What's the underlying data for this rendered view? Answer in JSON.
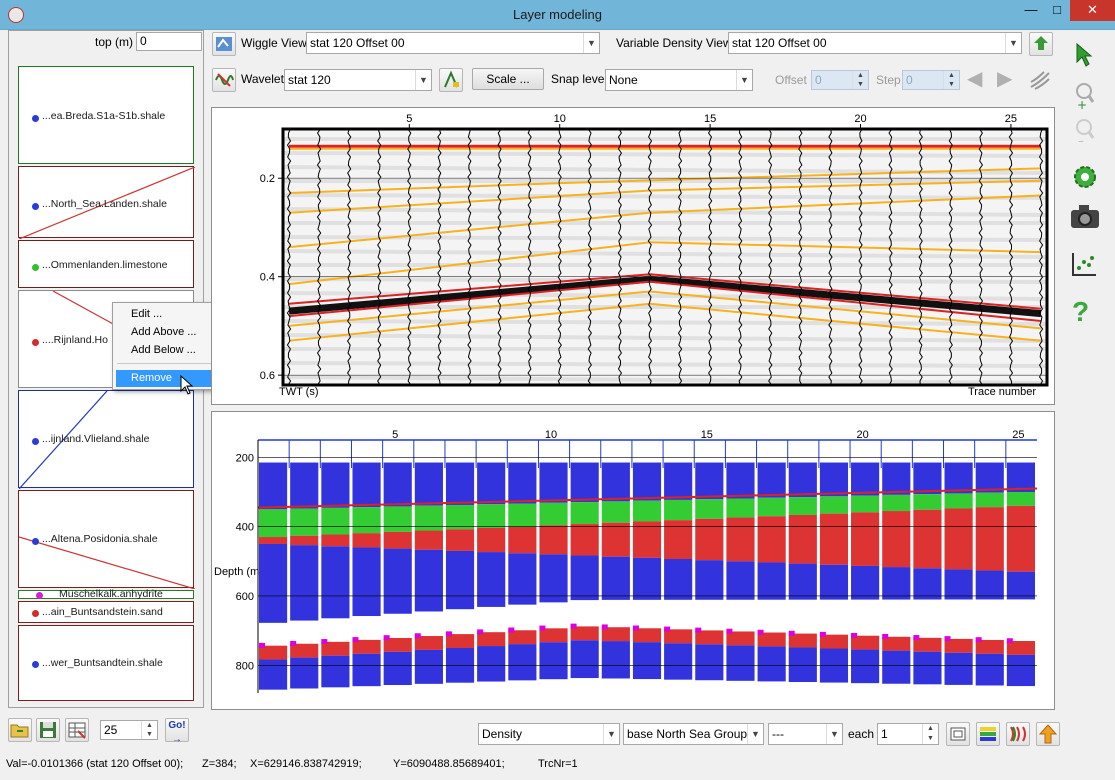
{
  "window": {
    "title": "Layer modeling"
  },
  "top": {
    "label": "top (m)",
    "value": "0"
  },
  "layers": [
    {
      "name": "...ea.Breda.S1a-S1b.shale",
      "dot": "#2b3bd9",
      "border": "#1f7a1f"
    },
    {
      "name": "...North_Sea.Landen.shale",
      "dot": "#2b3bd9",
      "border": "#7a1f1f"
    },
    {
      "name": "...Ommenlanden.limestone",
      "dot": "#2fbf2f",
      "border": "#6b1f1f"
    },
    {
      "name": "....Rijnland.Ho",
      "dot": "#d42a2a",
      "border": "#8a8a8a"
    },
    {
      "name": "...ijnland.Vlieland.shale",
      "dot": "#2b3bd9",
      "border": "#1f2f9a"
    },
    {
      "name": "...Altena.Posidonia.shale",
      "dot": "#2b3bd9",
      "border": "#7a1f1f"
    },
    {
      "name": "Muschelkalk.anhydrite",
      "dot": "#d420d4",
      "border": "#2a7a2a"
    },
    {
      "name": "...ain_Buntsandstein.sand",
      "dot": "#d42a2a",
      "border": "#7a1f1f"
    },
    {
      "name": "...wer_Buntsandtein.shale",
      "dot": "#2b3bd9",
      "border": "#7a1f1f"
    }
  ],
  "context_menu": {
    "items": [
      "Edit ...",
      "Add Above ...",
      "Add Below ...",
      "Remove"
    ],
    "selected": "Remove"
  },
  "toolbar1": {
    "wiggle_label": "Wiggle View",
    "wiggle_value": "stat 120 Offset 00",
    "vd_label": "Variable Density View",
    "vd_value": "stat 120 Offset 00"
  },
  "toolbar2": {
    "wavelet_label": "Wavelet",
    "wavelet_value": "stat 120",
    "scale_label": "Scale ...",
    "snap_label": "Snap level",
    "snap_value": "None",
    "offset_label": "Offset",
    "offset_value": "0",
    "step_label": "Step",
    "step_value": "0"
  },
  "seismic": {
    "x_ticks": [
      "5",
      "10",
      "15",
      "20",
      "25"
    ],
    "y_ticks": [
      "0.2",
      "0.4",
      "0.6"
    ],
    "y_axis_label": "TWT (s)",
    "x_axis_label": "Trace number"
  },
  "depth": {
    "x_ticks": [
      "5",
      "10",
      "15",
      "20",
      "25"
    ],
    "y_ticks": [
      "200",
      "400",
      "600",
      "800"
    ],
    "y_axis_label": "Depth (m"
  },
  "bottom": {
    "spin_value": "25",
    "go_label": "Go!",
    "property": "Density",
    "horizon": "base North Sea Group",
    "mode": "---",
    "each_label": "each",
    "each_value": "1"
  },
  "status": {
    "val": "Val=-0.0101366 (stat 120 Offset 00);",
    "z": "Z=384;",
    "x": "X=629146.838742919;",
    "y": "Y=6090488.85689401;",
    "trc": "TrcNr=1"
  },
  "colors": {
    "blue": "#3333dd",
    "red": "#dd3333",
    "green": "#33cc33",
    "magenta": "#dd00dd",
    "white": "#ffffff"
  }
}
